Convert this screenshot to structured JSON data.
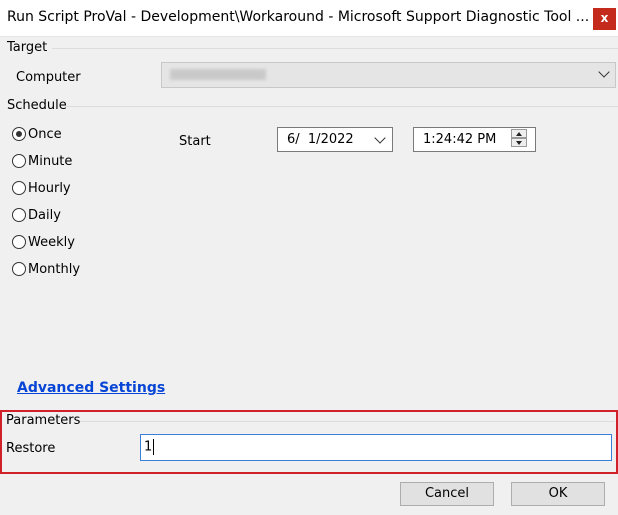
{
  "window": {
    "title": "Run Script ProVal - Development\\Workaround - Microsoft Support Diagnostic Tool ...",
    "close_glyph": "x"
  },
  "target": {
    "group_label": "Target",
    "computer_label": "Computer",
    "computer_value": "",
    "icon": "chevron-down-icon"
  },
  "schedule": {
    "group_label": "Schedule",
    "options": [
      "Once",
      "Minute",
      "Hourly",
      "Daily",
      "Weekly",
      "Monthly"
    ],
    "selected": "Once",
    "start_label": "Start",
    "date_value": "6/  1/2022",
    "time_value": "1:24:42 PM"
  },
  "advanced_settings_label": "Advanced Settings",
  "parameters": {
    "group_label": "Parameters",
    "restore_label": "Restore",
    "restore_value": "1"
  },
  "buttons": {
    "cancel": "Cancel",
    "ok": "OK"
  },
  "colors": {
    "highlight": "#d0202a",
    "link": "#0645d6",
    "close": "#c42b1c"
  }
}
